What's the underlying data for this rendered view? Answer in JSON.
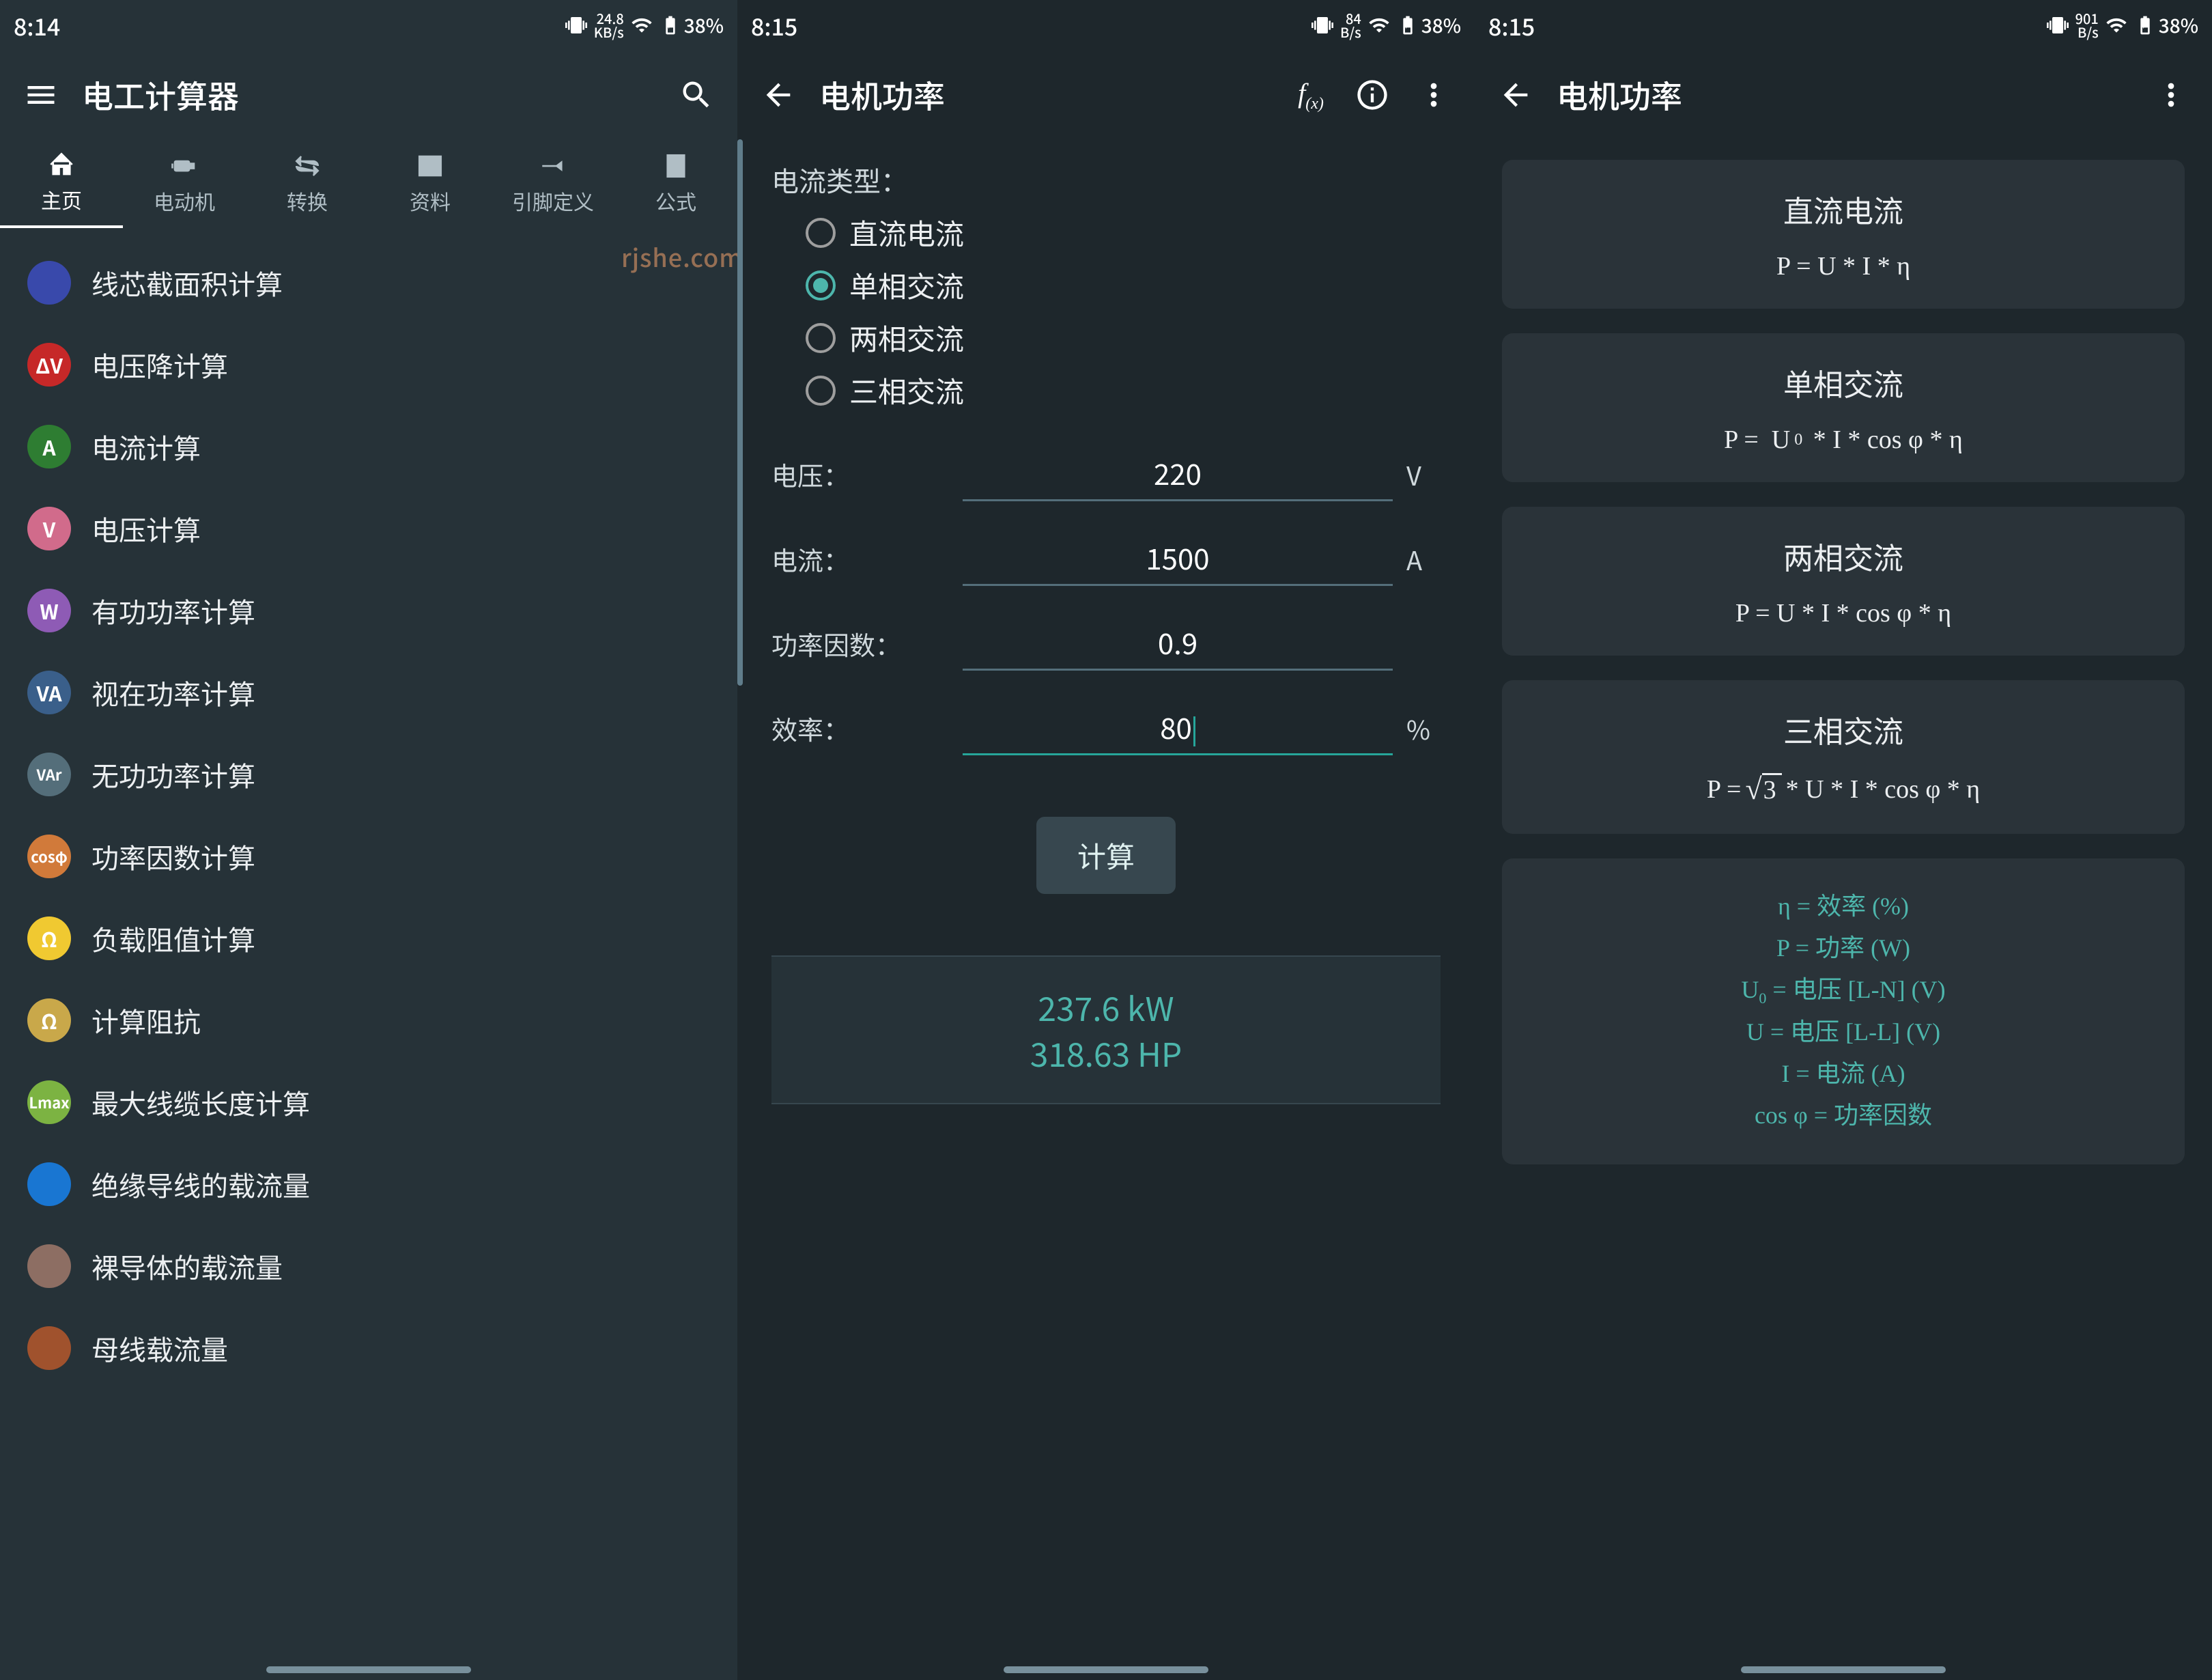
{
  "screen1": {
    "status": {
      "time": "8:14",
      "speed": "24.8",
      "speed_unit": "KB/s",
      "battery": "38%"
    },
    "appbar": {
      "title": "电工计算器"
    },
    "tabs": [
      {
        "label": "主页"
      },
      {
        "label": "电动机"
      },
      {
        "label": "转换"
      },
      {
        "label": "资料"
      },
      {
        "label": "引脚定义"
      },
      {
        "label": "公式"
      }
    ],
    "items": [
      {
        "label": "线芯截面积计算",
        "bg": "#3949ab",
        "txt": ""
      },
      {
        "label": "电压降计算",
        "bg": "#c62828",
        "txt": "ΔV"
      },
      {
        "label": "电流计算",
        "bg": "#2e7d32",
        "txt": "A"
      },
      {
        "label": "电压计算",
        "bg": "#d16b8b",
        "txt": "V"
      },
      {
        "label": "有功功率计算",
        "bg": "#8e5bb5",
        "txt": "W"
      },
      {
        "label": "视在功率计算",
        "bg": "#3a5f8a",
        "txt": "VA"
      },
      {
        "label": "无功功率计算",
        "bg": "#546e7a",
        "txt": "VAr"
      },
      {
        "label": "功率因数计算",
        "bg": "#d17a3a",
        "txt": "cosφ"
      },
      {
        "label": "负载阻值计算",
        "bg": "#f0c931",
        "txt": "Ω"
      },
      {
        "label": "计算阻抗",
        "bg": "#c9a84a",
        "txt": "Ω"
      },
      {
        "label": "最大线缆长度计算",
        "bg": "#7cb342",
        "txt": "Lmax"
      },
      {
        "label": "绝缘导线的载流量",
        "bg": "#1976d2",
        "txt": ""
      },
      {
        "label": "裸导体的载流量",
        "bg": "#8d6e63",
        "txt": ""
      },
      {
        "label": "母线载流量",
        "bg": "#a0522d",
        "txt": ""
      }
    ],
    "watermark": "rjshe.com"
  },
  "screen2": {
    "status": {
      "time": "8:15",
      "speed": "84",
      "speed_unit": "B/s",
      "battery": "38%"
    },
    "appbar": {
      "title": "电机功率"
    },
    "group_label": "电流类型：",
    "radios": [
      {
        "label": "直流电流"
      },
      {
        "label": "单相交流"
      },
      {
        "label": "两相交流"
      },
      {
        "label": "三相交流"
      }
    ],
    "fields": {
      "voltage": {
        "label": "电压：",
        "value": "220",
        "unit": "V"
      },
      "current": {
        "label": "电流：",
        "value": "1500",
        "unit": "A"
      },
      "pf": {
        "label": "功率因数：",
        "value": "0.9",
        "unit": ""
      },
      "eff": {
        "label": "效率：",
        "value": "80",
        "unit": "%"
      }
    },
    "button": "计算",
    "result": {
      "line1": "237.6 kW",
      "line2": "318.63 HP"
    }
  },
  "screen3": {
    "status": {
      "time": "8:15",
      "speed": "901",
      "speed_unit": "B/s",
      "battery": "38%"
    },
    "appbar": {
      "title": "电机功率"
    },
    "cards": [
      {
        "title": "直流电流",
        "formula": "P = U * I * η"
      },
      {
        "title": "单相交流",
        "formula_u0": "P =  U₀ * I * cos φ * η"
      },
      {
        "title": "两相交流",
        "formula": "P = U * I * cos φ * η"
      },
      {
        "title": "三相交流",
        "formula_sqrt": {
          "prefix": "P = ",
          "root": "3",
          "suffix": " * U * I * cos φ * η"
        }
      }
    ],
    "legend": [
      "η = 效率 (%)",
      "P = 功率 (W)",
      "U₀ = 电压 [L-N] (V)",
      "U = 电压 [L-L] (V)",
      "I = 电流 (A)",
      "cos φ = 功率因数"
    ]
  }
}
